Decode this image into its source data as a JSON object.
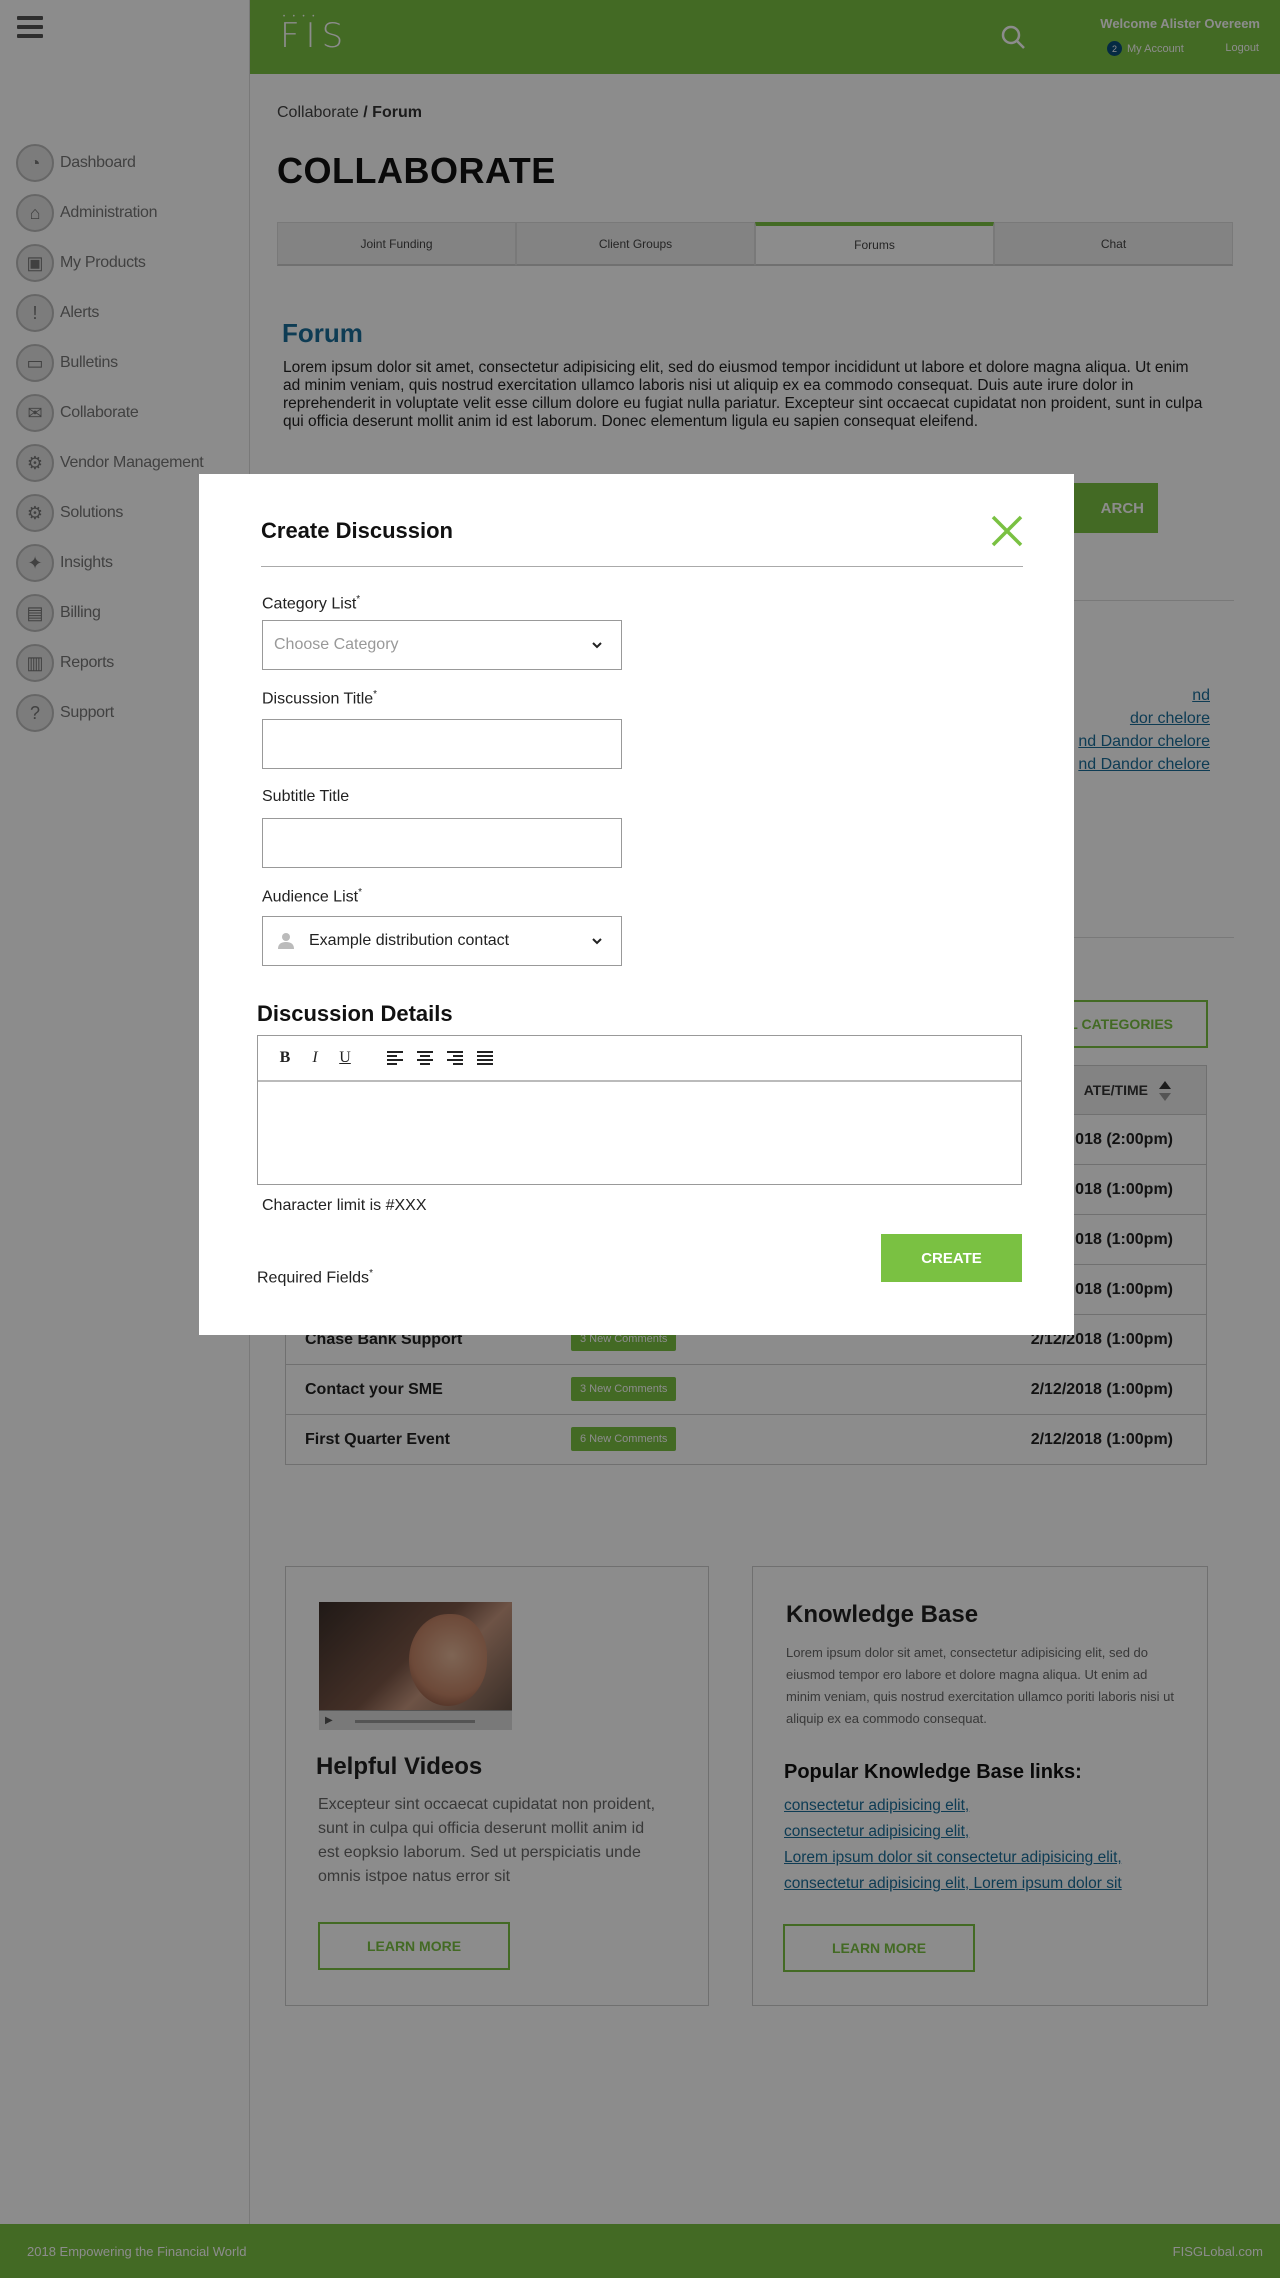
{
  "header": {
    "logo": "FIS",
    "welcome": "Welcome Alister Overeem",
    "account_badge": "2",
    "my_account": "My Account",
    "logout": "Logout"
  },
  "sidebar": {
    "items": [
      {
        "label": "Dashboard",
        "icon": "dashboard-icon"
      },
      {
        "label": "Administration",
        "icon": "bank-icon"
      },
      {
        "label": "My Products",
        "icon": "box-icon"
      },
      {
        "label": "Alerts",
        "icon": "alert-icon"
      },
      {
        "label": "Bulletins",
        "icon": "folder-icon"
      },
      {
        "label": "Collaborate",
        "icon": "chat-icon"
      },
      {
        "label": "Vendor Management",
        "icon": "vendor-icon"
      },
      {
        "label": "Solutions",
        "icon": "gears-icon"
      },
      {
        "label": "Insights",
        "icon": "lightbulb-icon"
      },
      {
        "label": "Billing",
        "icon": "document-icon"
      },
      {
        "label": "Reports",
        "icon": "clipboard-icon"
      },
      {
        "label": "Support",
        "icon": "question-icon"
      }
    ]
  },
  "breadcrumb": {
    "parent": "Collaborate",
    "sep": " / ",
    "current": "Forum"
  },
  "page_title": "COLLABORATE",
  "tabs": [
    {
      "label": "Joint Funding"
    },
    {
      "label": "Client Groups"
    },
    {
      "label": "Forums"
    },
    {
      "label": "Chat"
    }
  ],
  "forum": {
    "title": "Forum",
    "description": "Lorem ipsum dolor sit amet, consectetur adipisicing elit, sed do eiusmod tempor incididunt ut labore et dolore magna aliqua. Ut enim ad minim veniam, quis nostrud exercitation ullamco laboris nisi ut aliquip ex ea commodo consequat. Duis aute irure dolor in reprehenderit in voluptate velit esse cillum dolore eu fugiat nulla pariatur. Excepteur sint occaecat cupidatat non proident, sunt in culpa qui officia deserunt mollit anim id est laborum. Donec elementum ligula eu sapien consequat eleifend."
  },
  "search_button": "ARCH",
  "partial_links": [
    "nd",
    "dor chelore",
    "nd Dandor chelore",
    "nd Dandor chelore"
  ],
  "categories_button": "L CATEGORIES",
  "table": {
    "date_header": "ATE/TIME",
    "rows": [
      {
        "title": "",
        "badge": "",
        "date": "018 (2:00pm)"
      },
      {
        "title": "",
        "badge": "",
        "date": "018 (1:00pm)"
      },
      {
        "title": "",
        "badge": "",
        "date": "018 (1:00pm)"
      },
      {
        "title": "",
        "badge": "",
        "date": "018 (1:00pm)"
      },
      {
        "title": "Chase Bank Support",
        "badge": "3 New Comments",
        "date": "2/12/2018 (1:00pm)"
      },
      {
        "title": "Contact your SME",
        "badge": "3 New Comments",
        "date": "2/12/2018 (1:00pm)"
      },
      {
        "title": "First Quarter Event",
        "badge": "6 New Comments",
        "date": "2/12/2018 (1:00pm)"
      }
    ]
  },
  "helpful_videos": {
    "heading": "Helpful Videos",
    "text": "Excepteur sint occaecat cupidatat non proident, sunt in culpa qui officia deserunt mollit anim id est eopksio laborum. Sed ut perspiciatis unde omnis istpoe natus error sit",
    "button": "LEARN MORE"
  },
  "knowledge_base": {
    "heading": "Knowledge Base",
    "text": "Lorem ipsum dolor sit amet, consectetur adipisicing elit, sed do eiusmod tempor ero labore et dolore magna aliqua. Ut enim ad minim veniam, quis nostrud exercitation ullamco poriti laboris nisi ut aliquip ex ea commodo consequat.",
    "links_heading": "Popular Knowledge Base links:",
    "links": [
      "consectetur adipisicing elit, ",
      "consectetur adipisicing elit, ",
      "Lorem ipsum dolor sit consectetur adipisicing elit, ",
      "consectetur adipisicing elit, Lorem ipsum dolor sit"
    ],
    "button": "LEARN MORE"
  },
  "footer": {
    "left": "2018 Empowering the Financial World",
    "right": "FISGLobal.com"
  },
  "modal": {
    "title": "Create Discussion",
    "category_label": "Category List",
    "category_placeholder": "Choose Category",
    "discussion_title_label": "Discussion Title",
    "subtitle_label": "Subtitle Title",
    "audience_label": "Audience List",
    "audience_value": "Example distribution contact",
    "details_heading": "Discussion Details",
    "toolbar": {
      "bold": "B",
      "italic": "I",
      "underline": "U"
    },
    "char_limit": "Character limit is #XXX",
    "required": "Required Fields",
    "asterisk": "*",
    "create_button": "CREATE"
  },
  "colors": {
    "brand_green": "#7ac142",
    "link_blue": "#1a6d9a"
  }
}
